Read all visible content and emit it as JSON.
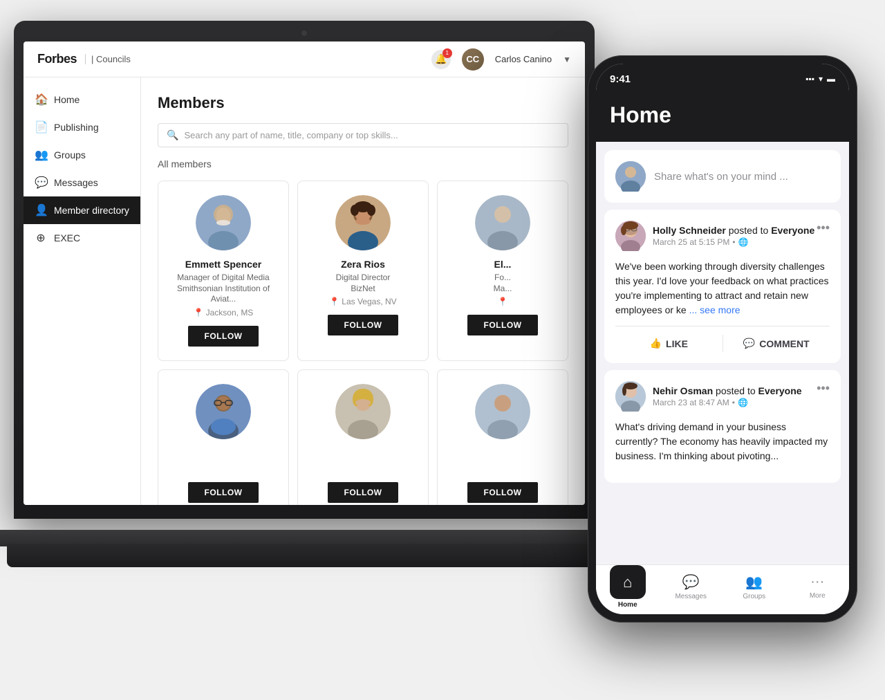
{
  "scene": {
    "background": "#f0f0f0"
  },
  "laptop": {
    "header": {
      "logo_forbes": "Forbes",
      "logo_councils": "| Councils",
      "user_name": "Carlos Canino",
      "notification_count": "1"
    },
    "sidebar": {
      "items": [
        {
          "id": "home",
          "label": "Home",
          "icon": "🏠",
          "active": false
        },
        {
          "id": "publishing",
          "label": "Publishing",
          "icon": "📄",
          "active": false
        },
        {
          "id": "groups",
          "label": "Groups",
          "icon": "👥",
          "active": false
        },
        {
          "id": "messages",
          "label": "Messages",
          "icon": "💬",
          "active": false
        },
        {
          "id": "member-directory",
          "label": "Member directory",
          "icon": "👤",
          "active": true
        },
        {
          "id": "exec",
          "label": "EXEC",
          "icon": "⊕",
          "active": false
        }
      ]
    },
    "members_page": {
      "title": "Members",
      "search_placeholder": "Search any part of name, title, company or top skills...",
      "filter_label": "All members",
      "members": [
        {
          "name": "Emmett Spencer",
          "title": "Manager of Digital Media",
          "company": "Smithsonian Institution of Aviat...",
          "location": "Jackson, MS",
          "follow_label": "FOLLOW",
          "avatar_color": "#8fa8c8"
        },
        {
          "name": "Zera Rios",
          "title": "Digital Director",
          "company": "BizNet",
          "location": "Las Vegas, NV",
          "follow_label": "FOLLOW",
          "avatar_color": "#c8a882"
        },
        {
          "name": "El...",
          "title": "Fo...",
          "company": "Ma...",
          "location": "...",
          "follow_label": "FOLLOW",
          "avatar_color": "#a8b8c8"
        },
        {
          "name": "",
          "title": "",
          "company": "",
          "location": "",
          "follow_label": "FOLLOW",
          "avatar_color": "#7090c0"
        },
        {
          "name": "",
          "title": "",
          "company": "",
          "location": "",
          "follow_label": "FOLLOW",
          "avatar_color": "#c8c0b0"
        },
        {
          "name": "",
          "title": "",
          "company": "",
          "location": "",
          "follow_label": "FOLLOW",
          "avatar_color": "#b0c0d0"
        }
      ]
    }
  },
  "phone": {
    "status_bar": {
      "time": "9:41",
      "signal": "📶",
      "wifi": "📡",
      "battery": "🔋"
    },
    "home": {
      "title": "Home",
      "share_placeholder": "Share what's on your mind ...",
      "posts": [
        {
          "id": "post1",
          "user_name": "Holly Schneider",
          "posted_to": "posted to",
          "audience": "Everyone",
          "date": "March 25 at 5:15 PM",
          "text": "We've been working through diversity challenges this year. I'd love your feedback on what practices you're implementing to attract and retain new employees or ke",
          "see_more": "... see more",
          "like_label": "LIKE",
          "comment_label": "COMMENT"
        },
        {
          "id": "post2",
          "user_name": "Nehir Osman",
          "posted_to": "posted to",
          "audience": "Everyone",
          "date": "March 23 at 8:47 AM",
          "text": "What's driving demand in your business currently? The economy has heavily impacted my business. I'm thinking about pivoting...",
          "see_more": "",
          "like_label": "LIKE",
          "comment_label": "COMMENT"
        }
      ],
      "tab_bar": [
        {
          "id": "home",
          "label": "Home",
          "icon": "⌂",
          "active": true
        },
        {
          "id": "messages",
          "label": "Messages",
          "icon": "💬",
          "active": false
        },
        {
          "id": "groups",
          "label": "Groups",
          "icon": "👥",
          "active": false
        },
        {
          "id": "more",
          "label": "More",
          "icon": "•••",
          "active": false
        }
      ]
    }
  }
}
